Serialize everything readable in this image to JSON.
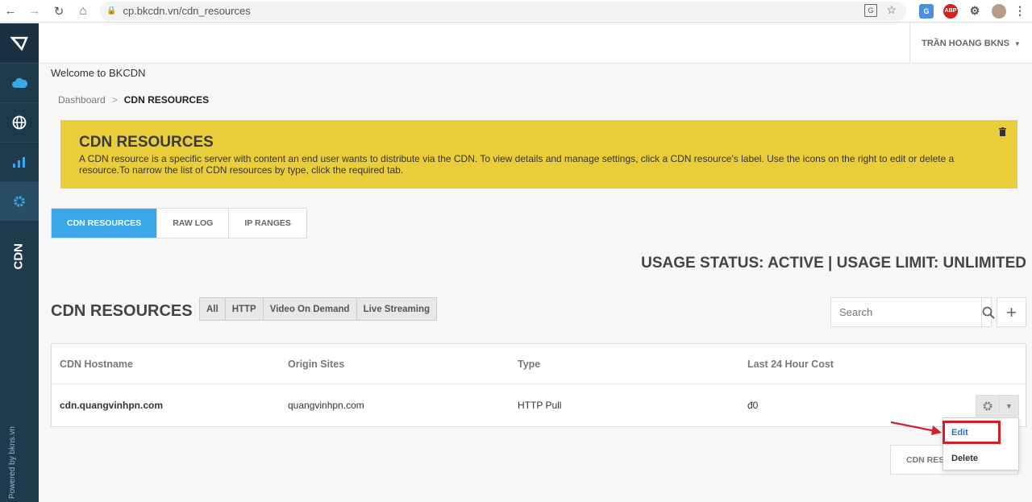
{
  "browser": {
    "url": "cp.bkcdn.vn/cdn_resources"
  },
  "sidebar": {
    "section_label": "CDN",
    "powered_by": "Powered by bkns.vn"
  },
  "header": {
    "user_name": "TRẦN HOANG BKNS"
  },
  "welcome": "Welcome to BKCDN",
  "breadcrumb": {
    "home": "Dashboard",
    "separator": ">",
    "current": "CDN RESOURCES"
  },
  "alert": {
    "title": "CDN RESOURCES",
    "body": "A CDN resource is a specific server with content an end user wants to distribute via the CDN. To view details and manage settings, click a CDN resource's label. Use the icons on the right to edit or delete a resource.To narrow the list of CDN resources by type, click the required tab.",
    "bg_color": "#e9cd3b"
  },
  "tabs": [
    {
      "label": "CDN RESOURCES",
      "active": true
    },
    {
      "label": "RAW LOG",
      "active": false
    },
    {
      "label": "IP RANGES",
      "active": false
    }
  ],
  "usage_status": "USAGE STATUS: ACTIVE | USAGE LIMIT: UNLIMITED",
  "resources": {
    "title": "CDN RESOURCES",
    "filters": [
      "All",
      "HTTP",
      "Video On Demand",
      "Live Streaming"
    ],
    "search_placeholder": "Search",
    "columns": [
      "CDN Hostname",
      "Origin Sites",
      "Type",
      "Last 24 Hour Cost"
    ],
    "rows": [
      {
        "hostname": "cdn.quangvinhpn.com",
        "origin": "quangvinhpn.com",
        "type": "HTTP Pull",
        "cost": "đ0"
      }
    ],
    "bottom_button": "CDN RESOURCES"
  },
  "dropdown": {
    "edit": "Edit",
    "delete": "Delete"
  },
  "colors": {
    "sidebar": "#1f3a4d",
    "accent": "#3aa7e8",
    "highlight": "#d41f26"
  }
}
